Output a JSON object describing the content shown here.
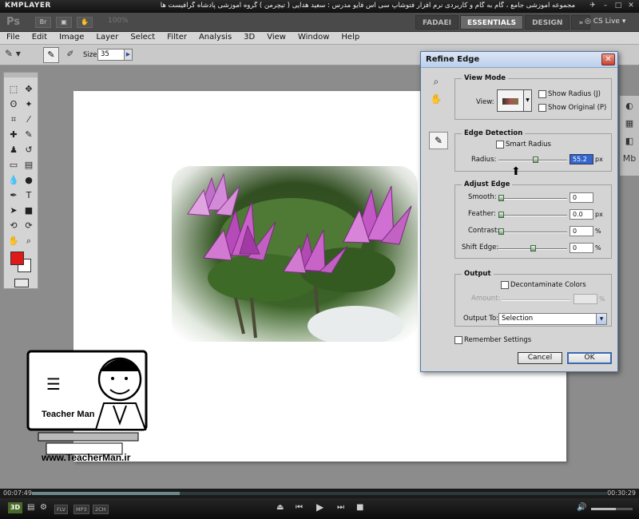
{
  "kmplayer": {
    "logo": "KMPLAYER",
    "title": "مجموعه آموزشی جامع ، گام به گام و کاربردی نرم افزار فتوشاپ سی اس فایو   مدرس : سعید هدایی ( تیچرمن ) گروه آموزشی پادشاه گرافیست ها",
    "time_elapsed": "00:07:49",
    "time_total": "00:30:29",
    "progress": 0.257,
    "volume": 0.6,
    "badges": [
      "FLV",
      "MP3",
      "2CH"
    ]
  },
  "photoshop": {
    "logo": "Ps",
    "zoom": "100%",
    "workspaces": [
      {
        "label": "FADAEI",
        "active": false
      },
      {
        "label": "ESSENTIALS",
        "active": true
      },
      {
        "label": "DESIGN",
        "active": false
      },
      {
        "label": "»",
        "active": false
      }
    ],
    "cs_live": "CS Live",
    "menu": [
      "File",
      "Edit",
      "Image",
      "Layer",
      "Select",
      "Filter",
      "Analysis",
      "3D",
      "View",
      "Window",
      "Help"
    ],
    "options": {
      "size_label": "Size:",
      "size_value": "35"
    },
    "colors": {
      "foreground": "#e01818",
      "background": "#ffffff"
    }
  },
  "dialog": {
    "title": "Refine Edge",
    "view_mode": {
      "heading": "View Mode",
      "view_label": "View:",
      "show_radius": "Show Radius (J)",
      "show_original": "Show Original (P)"
    },
    "edge_detection": {
      "heading": "Edge Detection",
      "smart_radius": "Smart Radius",
      "radius_label": "Radius:",
      "radius_value": "55.2",
      "radius_unit": "px",
      "radius_fraction": 0.55
    },
    "adjust_edge": {
      "heading": "Adjust Edge",
      "rows": [
        {
          "label": "Smooth:",
          "value": "0",
          "unit": "",
          "fraction": 0.0
        },
        {
          "label": "Feather:",
          "value": "0.0",
          "unit": "px",
          "fraction": 0.0
        },
        {
          "label": "Contrast:",
          "value": "0",
          "unit": "%",
          "fraction": 0.0
        },
        {
          "label": "Shift Edge:",
          "value": "0",
          "unit": "%",
          "fraction": 0.5
        }
      ]
    },
    "output": {
      "heading": "Output",
      "decontaminate": "Decontaminate Colors",
      "amount_label": "Amount:",
      "amount_unit": "%",
      "output_to_label": "Output To:",
      "output_to_value": "Selection"
    },
    "remember": "Remember Settings",
    "cancel": "Cancel",
    "ok": "OK"
  },
  "watermark": {
    "brand": "Teacher Man",
    "url": "www.TeacherMan.ir"
  }
}
